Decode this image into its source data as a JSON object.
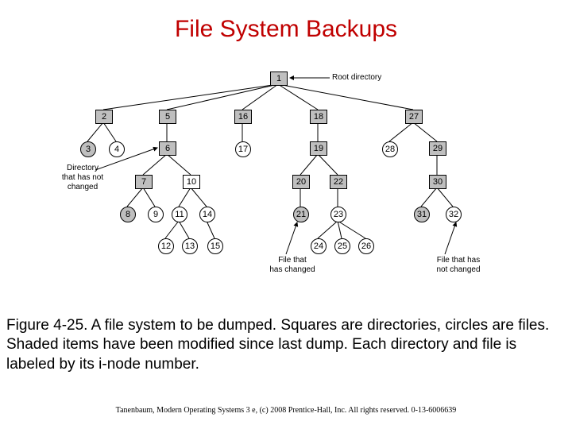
{
  "title": "File System Backups",
  "labels": {
    "root": "Root directory",
    "dir_unchanged_1": "Directory",
    "dir_unchanged_2": "that has not",
    "dir_unchanged_3": "changed",
    "file_changed_1": "File that",
    "file_changed_2": "has changed",
    "file_unchanged_1": "File that has",
    "file_unchanged_2": "not changed"
  },
  "nodes": {
    "1": "1",
    "2": "2",
    "3": "3",
    "4": "4",
    "5": "5",
    "6": "6",
    "7": "7",
    "8": "8",
    "9": "9",
    "10": "10",
    "11": "11",
    "12": "12",
    "13": "13",
    "14": "14",
    "15": "15",
    "16": "16",
    "17": "17",
    "18": "18",
    "19": "19",
    "20": "20",
    "21": "21",
    "22": "22",
    "23": "23",
    "24": "24",
    "25": "25",
    "26": "26",
    "27": "27",
    "28": "28",
    "29": "29",
    "30": "30",
    "31": "31",
    "32": "32"
  },
  "caption": "Figure 4-25. A file system to be dumped. Squares are directories, circles are files. Shaded items have been modified since last dump. Each directory and file is labeled by its i-node number.",
  "footer": "Tanenbaum, Modern Operating Systems 3 e, (c) 2008 Prentice-Hall, Inc. All rights reserved. 0-13-6006639",
  "chart_data": {
    "type": "tree",
    "node_shapes": {
      "square": "directory",
      "circle": "file"
    },
    "shaded_meaning": "modified since last dump",
    "nodes": [
      {
        "id": 1,
        "type": "directory",
        "shaded": true,
        "parent": null
      },
      {
        "id": 2,
        "type": "directory",
        "shaded": true,
        "parent": 1
      },
      {
        "id": 5,
        "type": "directory",
        "shaded": true,
        "parent": 1
      },
      {
        "id": 16,
        "type": "directory",
        "shaded": true,
        "parent": 1
      },
      {
        "id": 18,
        "type": "directory",
        "shaded": true,
        "parent": 1
      },
      {
        "id": 27,
        "type": "directory",
        "shaded": true,
        "parent": 1
      },
      {
        "id": 3,
        "type": "file",
        "shaded": true,
        "parent": 2
      },
      {
        "id": 4,
        "type": "file",
        "shaded": false,
        "parent": 2
      },
      {
        "id": 6,
        "type": "directory",
        "shaded": true,
        "parent": 5
      },
      {
        "id": 17,
        "type": "file",
        "shaded": false,
        "parent": 16
      },
      {
        "id": 19,
        "type": "directory",
        "shaded": true,
        "parent": 18
      },
      {
        "id": 28,
        "type": "file",
        "shaded": false,
        "parent": 27
      },
      {
        "id": 29,
        "type": "directory",
        "shaded": true,
        "parent": 27
      },
      {
        "id": 7,
        "type": "directory",
        "shaded": true,
        "parent": 6
      },
      {
        "id": 10,
        "type": "directory",
        "shaded": false,
        "parent": 6
      },
      {
        "id": 20,
        "type": "directory",
        "shaded": true,
        "parent": 19
      },
      {
        "id": 22,
        "type": "directory",
        "shaded": true,
        "parent": 19
      },
      {
        "id": 30,
        "type": "directory",
        "shaded": true,
        "parent": 29
      },
      {
        "id": 8,
        "type": "file",
        "shaded": true,
        "parent": 7
      },
      {
        "id": 9,
        "type": "file",
        "shaded": false,
        "parent": 7
      },
      {
        "id": 11,
        "type": "file",
        "shaded": false,
        "parent": 10
      },
      {
        "id": 14,
        "type": "file",
        "shaded": false,
        "parent": 10
      },
      {
        "id": 21,
        "type": "file",
        "shaded": true,
        "parent": 20
      },
      {
        "id": 23,
        "type": "file",
        "shaded": false,
        "parent": 22
      },
      {
        "id": 31,
        "type": "file",
        "shaded": true,
        "parent": 30
      },
      {
        "id": 32,
        "type": "file",
        "shaded": false,
        "parent": 30
      },
      {
        "id": 12,
        "type": "file",
        "shaded": false,
        "parent": 11
      },
      {
        "id": 13,
        "type": "file",
        "shaded": false,
        "parent": 11
      },
      {
        "id": 15,
        "type": "file",
        "shaded": false,
        "parent": 14
      },
      {
        "id": 24,
        "type": "file",
        "shaded": false,
        "parent": 23
      },
      {
        "id": 25,
        "type": "file",
        "shaded": false,
        "parent": 23
      },
      {
        "id": 26,
        "type": "file",
        "shaded": false,
        "parent": 23
      }
    ]
  }
}
